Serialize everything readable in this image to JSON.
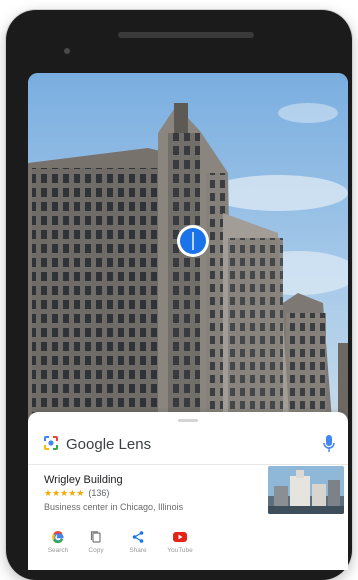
{
  "search_bar": {
    "title": "Google Lens"
  },
  "result": {
    "title": "Wrigley Building",
    "stars": "★★★★★",
    "rating_count": "(136)",
    "description": "Business center in Chicago, Illinois"
  },
  "actions": [
    {
      "label": "Search",
      "icon": "google-g-icon"
    },
    {
      "label": "Copy",
      "icon": "copy-icon"
    },
    {
      "label": "Share",
      "icon": "share-icon"
    },
    {
      "label": "YouTube",
      "icon": "youtube-icon"
    }
  ],
  "colors": {
    "accent_blue": "#1a73e8",
    "star_orange": "#f6a800",
    "youtube_red": "#e62117"
  }
}
